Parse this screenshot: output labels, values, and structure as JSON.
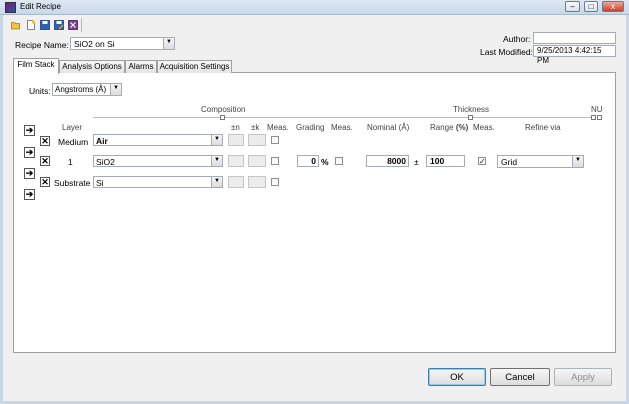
{
  "window": {
    "title": "Edit Recipe",
    "close_glyph": "x",
    "minimize_glyph": "–",
    "maximize_glyph": "□"
  },
  "toolbar": {
    "icons": [
      "open-folder-icon",
      "new-file-icon",
      "save-icon",
      "save-as-icon",
      "delete-recipe-icon"
    ]
  },
  "recipe": {
    "name_label": "Recipe Name:",
    "name_value": "SiO2 on Si"
  },
  "meta": {
    "author_label": "Author:",
    "author_value": "",
    "last_modified_label": "Last Modified:",
    "last_modified_value": "9/25/2013 4:42:15 PM"
  },
  "tabs": [
    {
      "label": "Film Stack",
      "active": true
    },
    {
      "label": "Analysis Options",
      "active": false
    },
    {
      "label": "Alarms",
      "active": false
    },
    {
      "label": "Acquisition Settings",
      "active": false
    }
  ],
  "units": {
    "label": "Units:",
    "value": "Angstroms (Å)"
  },
  "sections": {
    "composition": "Composition",
    "thickness": "Thickness",
    "nu": "NU"
  },
  "headers": {
    "layer": "Layer",
    "pm_n": "±n",
    "pm_k": "±k",
    "meas1": "Meas.",
    "grading": "Grading",
    "meas2": "Meas.",
    "nominal": "Nominal (Å)",
    "range": "Range",
    "range_unit": "(%)",
    "meas3": "Meas.",
    "refine": "Refine via"
  },
  "layers": [
    {
      "label": "Medium",
      "material": "Air"
    },
    {
      "label": "1",
      "material": "SiO2",
      "grading": "0",
      "grading_unit": "%",
      "nominal": "8000",
      "pm": "±",
      "range": "100",
      "thickness_measured": true,
      "refine": "Grid"
    },
    {
      "label": "Substrate",
      "material": "Si"
    }
  ],
  "buttons": {
    "ok": "OK",
    "cancel": "Cancel",
    "apply": "Apply"
  },
  "glyphs": {
    "insert": "➔",
    "delete": "✕",
    "dropdown": "▼",
    "check": "✓"
  }
}
